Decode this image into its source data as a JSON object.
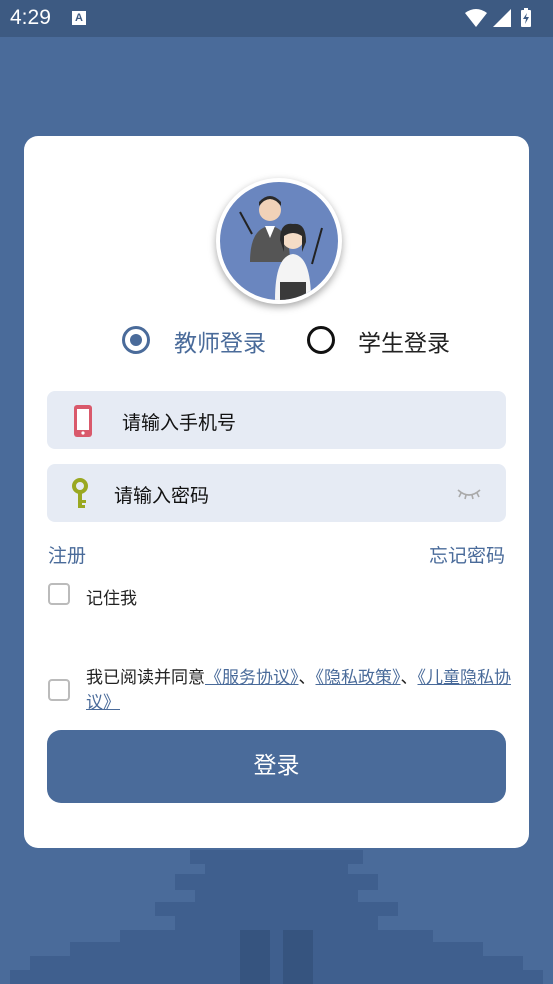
{
  "status_bar": {
    "time": "4:29",
    "notification_icon": "A"
  },
  "login": {
    "roles": [
      {
        "label": "教师登录",
        "selected": true
      },
      {
        "label": "学生登录",
        "selected": false
      }
    ],
    "phone_placeholder": "请输入手机号",
    "password_placeholder": "请输入密码",
    "register_link": "注册",
    "forgot_password_link": "忘记密码",
    "remember_me": "记住我",
    "agreement": {
      "prefix": "我已阅读并同意",
      "service_link": "《服务协议》",
      "sep1": "、",
      "privacy_link": "《隐私政策》",
      "sep2": "、",
      "child_privacy_link": "《儿童隐私协议》"
    },
    "login_button": "登录"
  },
  "colors": {
    "primary": "#4a6b9a",
    "field_bg": "#e6ebf4",
    "phone_icon": "#d9596b",
    "key_icon": "#9aa821"
  },
  "icons": [
    "phone-icon",
    "key-icon",
    "eye-closed-icon",
    "wifi-icon",
    "signal-icon",
    "battery-icon"
  ]
}
